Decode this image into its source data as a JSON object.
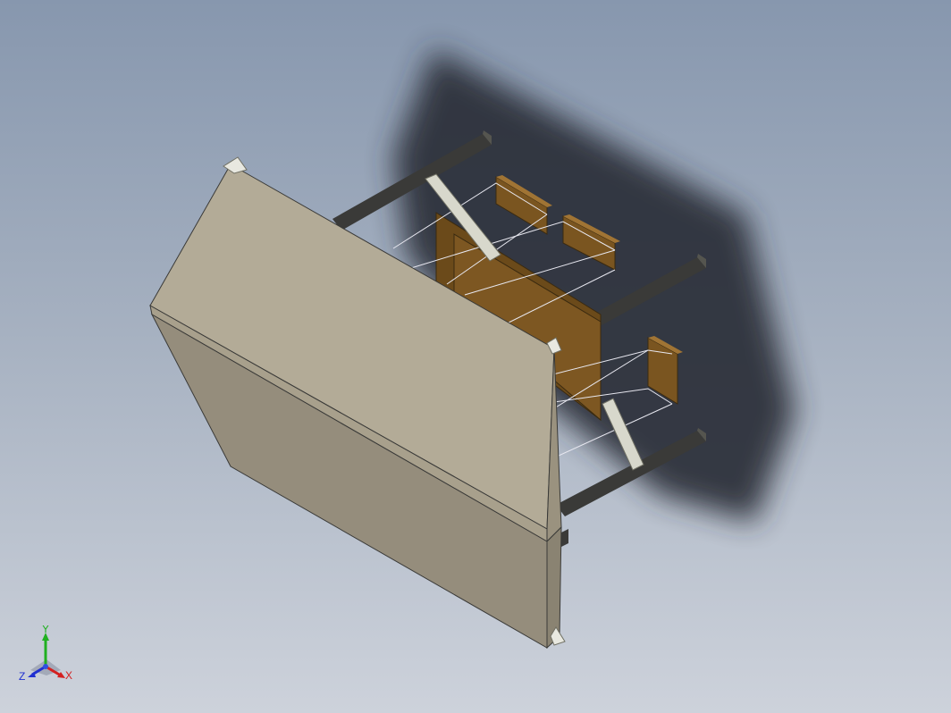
{
  "viewport": {
    "background_top": "#8797ae",
    "background_bottom": "#cdd2db"
  },
  "model": {
    "colors": {
      "tabletop_top": "#b3ab97",
      "tabletop_front": "#958d7c",
      "tabletop_edge": "#a8a08c",
      "leg": "#3a3a38",
      "rail": "#d8d8cc",
      "drawer": "#7a5520",
      "shadow": "#2b2f38"
    }
  },
  "triad": {
    "x_label": "X",
    "y_label": "Y",
    "z_label": "Z",
    "x_color": "#d42020",
    "y_color": "#20b020",
    "z_color": "#2030d0"
  }
}
